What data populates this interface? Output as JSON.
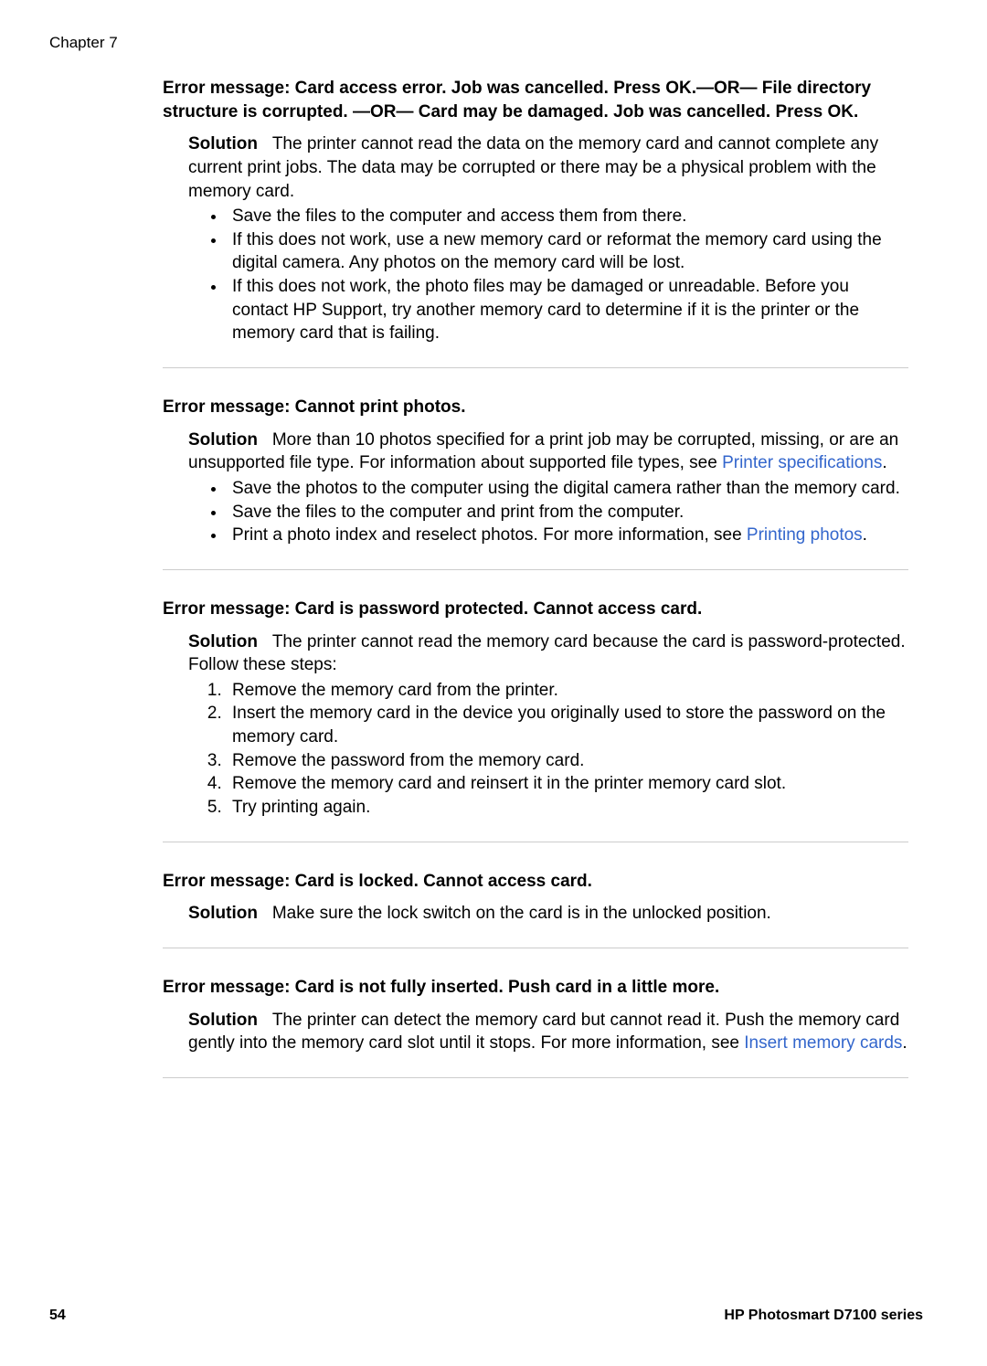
{
  "header": {
    "chapter": "Chapter 7"
  },
  "sections": [
    {
      "heading": "Error message: Card access error. Job was cancelled. Press OK.—OR— File directory structure is corrupted. —OR— Card may be damaged. Job was cancelled. Press OK.",
      "solution_label": "Solution",
      "solution_text": "The printer cannot read the data on the memory card and cannot complete any current print jobs. The data may be corrupted or there may be a physical problem with the memory card.",
      "bullets": [
        "Save the files to the computer and access them from there.",
        "If this does not work, use a new memory card or reformat the memory card using the digital camera. Any photos on the memory card will be lost.",
        "If this does not work, the photo files may be damaged or unreadable. Before you contact HP Support, try another memory card to determine if it is the printer or the memory card that is failing."
      ]
    },
    {
      "heading": "Error message: Cannot print photos.",
      "solution_label": "Solution",
      "solution_text_pre": "More than 10 photos specified for a print job may be corrupted, missing, or are an unsupported file type. For information about supported file types, see ",
      "solution_link": "Printer specifications",
      "solution_text_post": ".",
      "bullets": [
        "Save the photos to the computer using the digital camera rather than the memory card.",
        "Save the files to the computer and print from the computer."
      ],
      "bullet3_pre": "Print a photo index and reselect photos. For more information, see ",
      "bullet3_link": "Printing photos",
      "bullet3_post": "."
    },
    {
      "heading": "Error message: Card is password protected. Cannot access card.",
      "solution_label": "Solution",
      "solution_text": "The printer cannot read the memory card because the card is password-protected. Follow these steps:",
      "numlist": [
        "Remove the memory card from the printer.",
        "Insert the memory card in the device you originally used to store the password on the memory card.",
        "Remove the password from the memory card.",
        "Remove the memory card and reinsert it in the printer memory card slot.",
        "Try printing again."
      ]
    },
    {
      "heading": "Error message: Card is locked. Cannot access card.",
      "solution_label": "Solution",
      "solution_text": "Make sure the lock switch on the card is in the unlocked position."
    },
    {
      "heading": "Error message: Card is not fully inserted. Push card in a little more.",
      "solution_label": "Solution",
      "solution_text_pre": "The printer can detect the memory card but cannot read it. Push the memory card gently into the memory card slot until it stops. For more information, see ",
      "solution_link": "Insert memory cards",
      "solution_text_post": "."
    }
  ],
  "footer": {
    "page_number": "54",
    "title": "HP Photosmart D7100 series"
  }
}
